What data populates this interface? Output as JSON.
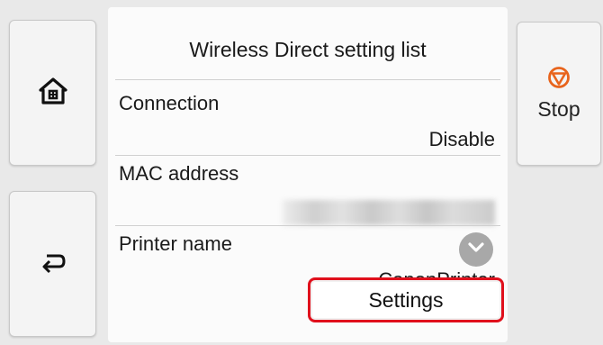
{
  "nav": {
    "home_icon": "home-icon",
    "back_icon": "back-arrow-icon"
  },
  "stop": {
    "label": "Stop",
    "icon": "stop-icon",
    "color": "#e8641c"
  },
  "list": {
    "title": "Wireless Direct setting list",
    "items": [
      {
        "label": "Connection",
        "value": "Disable"
      },
      {
        "label": "MAC address",
        "value": ""
      },
      {
        "label": "Printer name",
        "value": "CanonPrinter"
      }
    ]
  },
  "settings_button": {
    "label": "Settings",
    "highlight_color": "#e0101c"
  }
}
